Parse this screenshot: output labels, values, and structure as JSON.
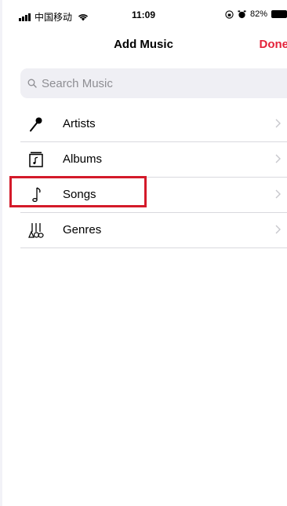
{
  "status_bar": {
    "carrier": "中国移动",
    "time": "11:09",
    "battery": "82%"
  },
  "nav": {
    "title": "Add Music",
    "done_label": "Done"
  },
  "search": {
    "placeholder": "Search Music"
  },
  "list": {
    "items": [
      {
        "label": "Artists",
        "icon": "microphone-icon"
      },
      {
        "label": "Albums",
        "icon": "album-icon"
      },
      {
        "label": "Songs",
        "icon": "music-note-icon"
      },
      {
        "label": "Genres",
        "icon": "guitars-icon"
      }
    ]
  },
  "colors": {
    "accent": "#e4223a",
    "highlight": "#d41a2a",
    "separator": "#d9d9de",
    "search_bg": "#efeff4",
    "placeholder": "#8e8e93"
  }
}
